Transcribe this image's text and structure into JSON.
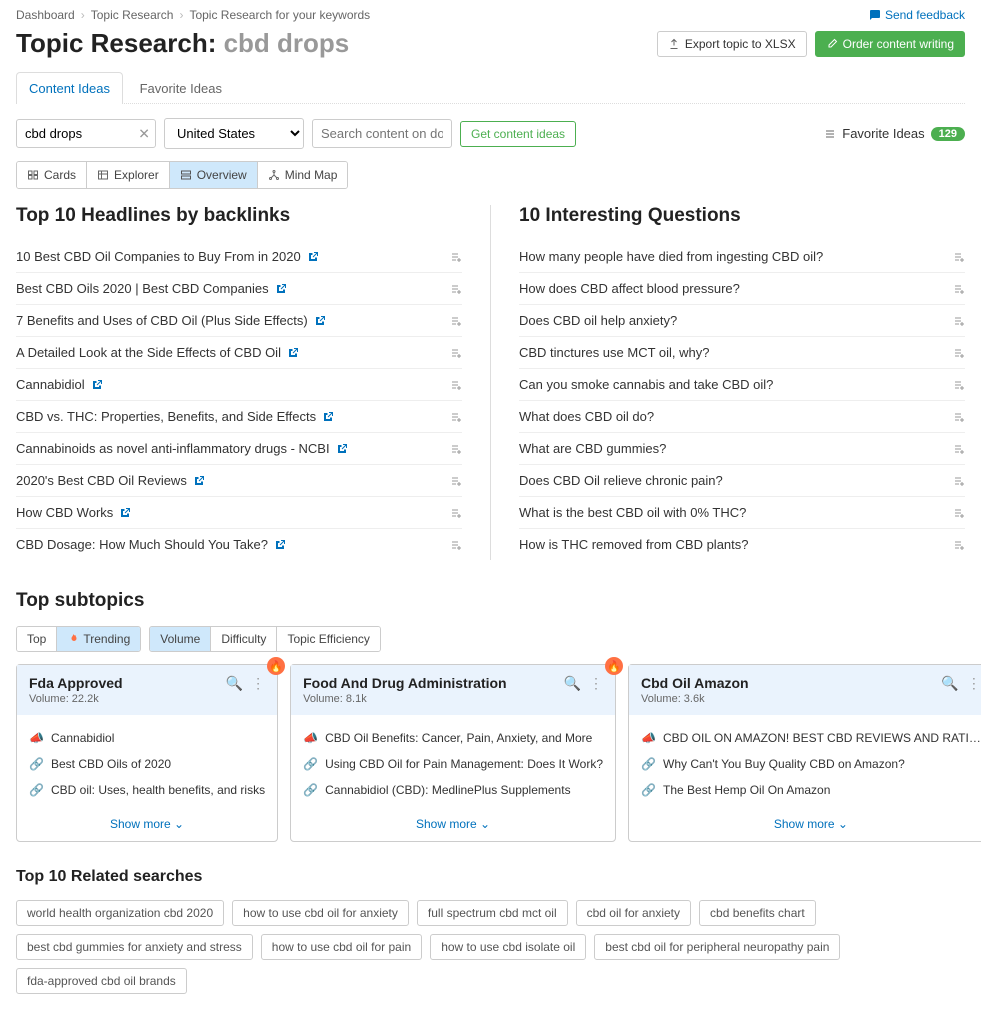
{
  "breadcrumb": [
    "Dashboard",
    "Topic Research",
    "Topic Research for your keywords"
  ],
  "feedback": "Send feedback",
  "title_prefix": "Topic Research:",
  "title_keyword": "cbd drops",
  "header_buttons": {
    "export": "Export topic to XLSX",
    "order": "Order content writing"
  },
  "main_tabs": [
    "Content Ideas",
    "Favorite Ideas"
  ],
  "search": {
    "keyword": "cbd drops",
    "country": "United States",
    "domain_placeholder": "Search content on domain",
    "get_ideas": "Get content ideas"
  },
  "favorite": {
    "label": "Favorite Ideas",
    "count": "129"
  },
  "views": [
    "Cards",
    "Explorer",
    "Overview",
    "Mind Map"
  ],
  "headlines_title": "Top 10 Headlines by backlinks",
  "headlines": [
    "10 Best CBD Oil Companies to Buy From in 2020",
    "Best CBD Oils 2020 | Best CBD Companies",
    "7 Benefits and Uses of CBD Oil (Plus Side Effects)",
    "A Detailed Look at the Side Effects of CBD Oil",
    "Cannabidiol",
    "CBD vs. THC: Properties, Benefits, and Side Effects",
    "Cannabinoids as novel anti-inflammatory drugs - NCBI",
    "2020's Best CBD Oil Reviews",
    "How CBD Works",
    "CBD Dosage: How Much Should You Take?"
  ],
  "questions_title": "10 Interesting Questions",
  "questions": [
    "How many people have died from ingesting CBD oil?",
    "How does CBD affect blood pressure?",
    "Does CBD oil help anxiety?",
    "CBD tinctures use MCT oil, why?",
    "Can you smoke cannabis and take CBD oil?",
    "What does CBD oil do?",
    "What are CBD gummies?",
    "Does CBD Oil relieve chronic pain?",
    "What is the best CBD oil with 0% THC?",
    "How is THC removed from CBD plants?"
  ],
  "subtopics_title": "Top subtopics",
  "filter1": [
    "Top",
    "Trending"
  ],
  "filter2": [
    "Volume",
    "Difficulty",
    "Topic Efficiency"
  ],
  "cards": [
    {
      "title": "Fda Approved",
      "volume": "Volume:  22.2k",
      "items": [
        {
          "icon": "green",
          "text": "Cannabidiol"
        },
        {
          "icon": "blue",
          "text": "Best CBD Oils of 2020"
        },
        {
          "icon": "blue",
          "text": "CBD oil: Uses, health benefits, and risks"
        }
      ]
    },
    {
      "title": "Food And Drug Administration",
      "volume": "Volume:  8.1k",
      "items": [
        {
          "icon": "green",
          "text": "CBD Oil Benefits: Cancer, Pain, Anxiety, and More"
        },
        {
          "icon": "blue",
          "text": "Using CBD Oil for Pain Management: Does It Work?"
        },
        {
          "icon": "blue",
          "text": "Cannabidiol (CBD): MedlinePlus Supplements"
        }
      ]
    },
    {
      "title": "Cbd Oil Amazon",
      "volume": "Volume:  3.6k",
      "items": [
        {
          "icon": "green",
          "text": "CBD OIL ON AMAZON! BEST CBD REVIEWS AND RATI…"
        },
        {
          "icon": "blue",
          "text": "Why Can't You Buy Quality CBD on Amazon?"
        },
        {
          "icon": "blue",
          "text": "The Best Hemp Oil On Amazon"
        }
      ]
    }
  ],
  "show_more": "Show more",
  "related_title": "Top 10 Related searches",
  "related": [
    "world health organization cbd 2020",
    "how to use cbd oil for anxiety",
    "full spectrum cbd mct oil",
    "cbd oil for anxiety",
    "cbd benefits chart",
    "best cbd gummies for anxiety and stress",
    "how to use cbd oil for pain",
    "how to use cbd isolate oil",
    "best cbd oil for peripheral neuropathy pain",
    "fda-approved cbd oil brands"
  ]
}
